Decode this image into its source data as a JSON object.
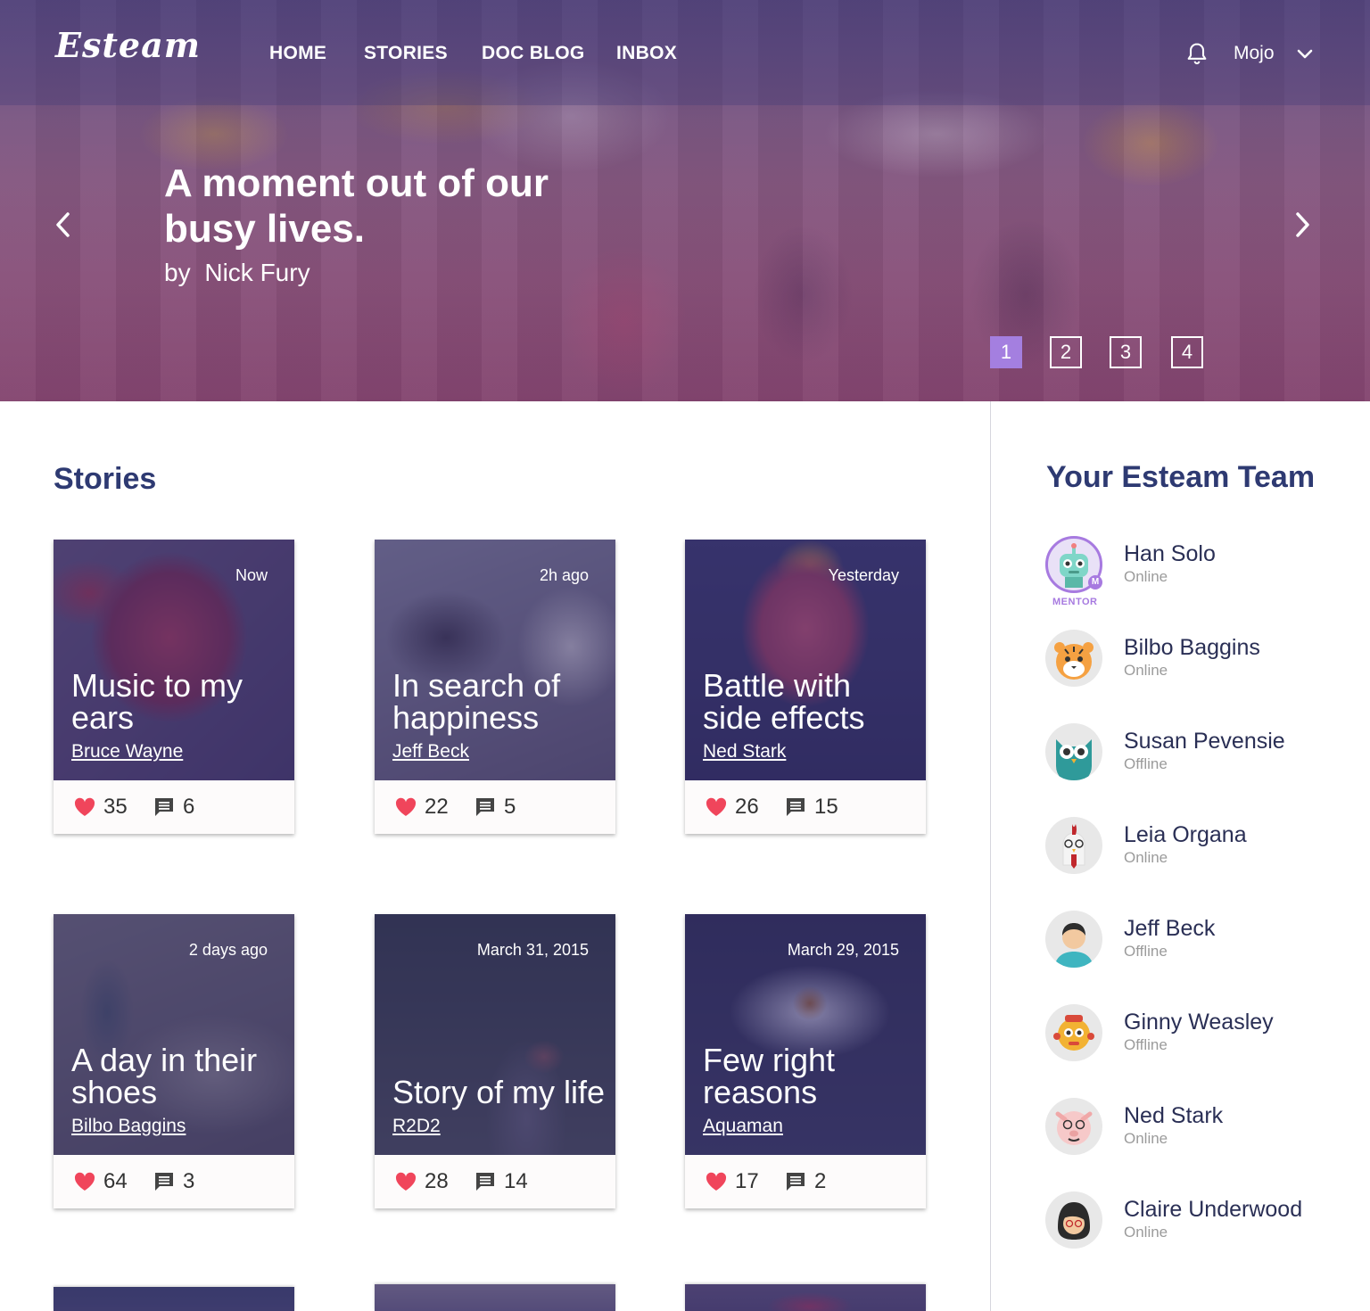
{
  "nav": {
    "logo": "Esteam",
    "links": [
      "HOME",
      "STORIES",
      "DOC BLOG",
      "INBOX"
    ],
    "user": "Mojo",
    "icons": {
      "notifications": "bell-icon",
      "menu": "chevron-down-icon"
    }
  },
  "hero": {
    "title": "A moment out of our busy lives.",
    "by": "by",
    "author": "Nick Fury",
    "pages": [
      "1",
      "2",
      "3",
      "4"
    ],
    "active_page": "1"
  },
  "stories": {
    "heading": "Stories",
    "cards": [
      {
        "time": "Now",
        "title": "Music to my ears",
        "author": "Bruce Wayne",
        "likes": "35",
        "comments": "6"
      },
      {
        "time": "2h ago",
        "title": "In search of happiness",
        "author": "Jeff Beck",
        "likes": "22",
        "comments": "5"
      },
      {
        "time": "Yesterday",
        "title": "Battle with side effects",
        "author": "Ned Stark",
        "likes": "26",
        "comments": "15"
      },
      {
        "time": "2 days ago",
        "title": "A day in their shoes",
        "author": "Bilbo Baggins",
        "likes": "64",
        "comments": "3"
      },
      {
        "time": "March 31, 2015",
        "title": "Story of my life",
        "author": "R2D2",
        "likes": "28",
        "comments": "14"
      },
      {
        "time": "March 29, 2015",
        "title": "Few right reasons",
        "author": "Aquaman",
        "likes": "17",
        "comments": "2"
      }
    ]
  },
  "team": {
    "heading": "Your Esteam Team",
    "mentor_label": "MENTOR",
    "mentor_badge": "M",
    "members": [
      {
        "name": "Han Solo",
        "status": "Online"
      },
      {
        "name": "Bilbo Baggins",
        "status": "Online"
      },
      {
        "name": "Susan Pevensie",
        "status": "Offline"
      },
      {
        "name": "Leia Organa",
        "status": "Online"
      },
      {
        "name": "Jeff Beck",
        "status": "Offline"
      },
      {
        "name": "Ginny Weasley",
        "status": "Offline"
      },
      {
        "name": "Ned Stark",
        "status": "Online"
      },
      {
        "name": "Claire Underwood",
        "status": "Online"
      }
    ]
  },
  "colors": {
    "accent": "#a47fe0",
    "heading": "#2e3a72",
    "heart": "#f0455b",
    "card_overlay": "#342e6e"
  }
}
